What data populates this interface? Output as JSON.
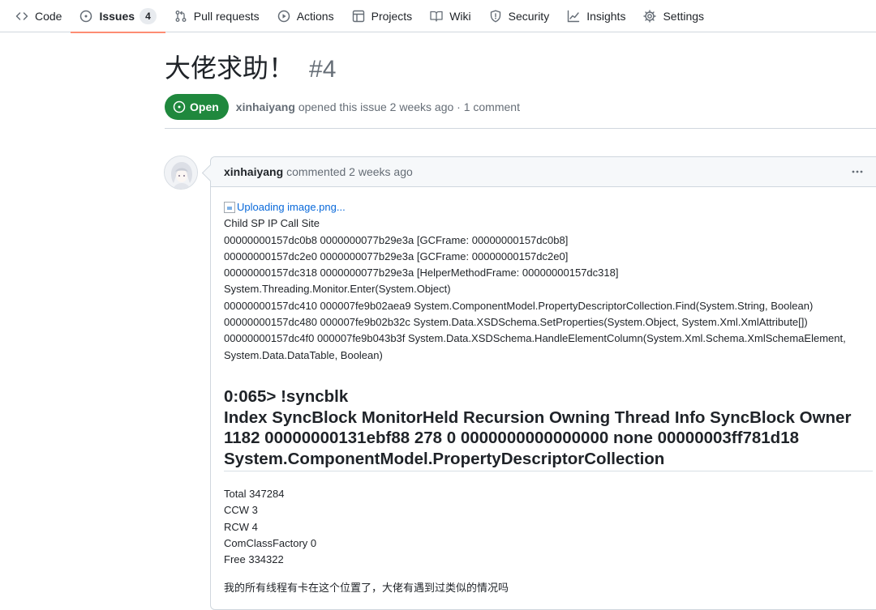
{
  "nav": {
    "items": [
      {
        "key": "code",
        "label": "Code",
        "icon": "code-icon"
      },
      {
        "key": "issues",
        "label": "Issues",
        "icon": "issue-opened-icon",
        "count": "4",
        "selected": true
      },
      {
        "key": "pulls",
        "label": "Pull requests",
        "icon": "git-pull-request-icon"
      },
      {
        "key": "actions",
        "label": "Actions",
        "icon": "play-icon"
      },
      {
        "key": "projects",
        "label": "Projects",
        "icon": "table-icon"
      },
      {
        "key": "wiki",
        "label": "Wiki",
        "icon": "book-icon"
      },
      {
        "key": "security",
        "label": "Security",
        "icon": "shield-icon"
      },
      {
        "key": "insights",
        "label": "Insights",
        "icon": "graph-icon"
      },
      {
        "key": "settings",
        "label": "Settings",
        "icon": "gear-icon"
      }
    ]
  },
  "issue": {
    "title": "大佬求助！",
    "number": "#4",
    "state": "Open",
    "author": "xinhaiyang",
    "meta_rest": "opened this issue 2 weeks ago · 1 comment"
  },
  "comment": {
    "author": "xinhaiyang",
    "time_text": "commented 2 weeks ago",
    "image_alt": "Uploading image.png...",
    "lines": [
      "Child SP IP Call Site",
      "00000000157dc0b8 0000000077b29e3a [GCFrame: 00000000157dc0b8]",
      "00000000157dc2e0 0000000077b29e3a [GCFrame: 00000000157dc2e0]",
      "00000000157dc318 0000000077b29e3a [HelperMethodFrame: 00000000157dc318]",
      "System.Threading.Monitor.Enter(System.Object)",
      "00000000157dc410 000007fe9b02aea9 System.ComponentModel.PropertyDescriptorCollection.Find(System.String, Boolean)",
      "00000000157dc480 000007fe9b02b32c System.Data.XSDSchema.SetProperties(System.Object, System.Xml.XmlAttribute[])",
      "00000000157dc4f0 000007fe9b043b3f System.Data.XSDSchema.HandleElementColumn(System.Xml.Schema.XmlSchemaElement,",
      "System.Data.DataTable, Boolean)"
    ],
    "heading_lines": [
      "0:065> !syncblk",
      "Index SyncBlock MonitorHeld Recursion Owning Thread Info SyncBlock Owner",
      "1182 00000000131ebf88 278 0 0000000000000000 none 00000003ff781d18",
      "System.ComponentModel.PropertyDescriptorCollection"
    ],
    "stats": [
      "Total 347284",
      "CCW 3",
      "RCW 4",
      "ComClassFactory 0",
      "Free 334322"
    ],
    "question": "我的所有线程有卡在这个位置了，大佬有遇到过类似的情况吗"
  },
  "colors": {
    "open_green": "#1f883d",
    "link_blue": "#0969da",
    "selected_underline": "#fd8c73",
    "muted_text": "#656d76",
    "border": "#d0d7de"
  }
}
